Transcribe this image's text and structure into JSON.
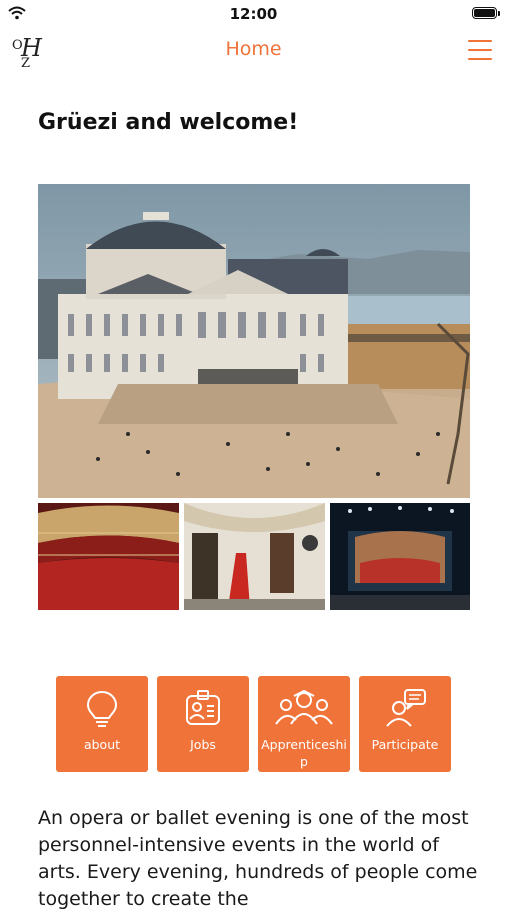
{
  "status_bar": {
    "time": "12:00"
  },
  "nav": {
    "logo": {
      "o": "O",
      "h": "H",
      "z": "Z"
    },
    "title": "Home"
  },
  "main": {
    "heading": "Grüezi and welcome!",
    "tiles": [
      {
        "label": "about",
        "icon": "lightbulb-icon"
      },
      {
        "label": "Jobs",
        "icon": "id-badge-icon"
      },
      {
        "label": "Apprenticeship",
        "icon": "group-people-icon"
      },
      {
        "label": "Participate",
        "icon": "person-chat-icon"
      }
    ],
    "intro_text": "An opera or ballet evening is one of the most personnel-intensive events in the world of arts. Every evening, hundreds of people come together to create the"
  },
  "colors": {
    "accent": "#f0733a"
  }
}
